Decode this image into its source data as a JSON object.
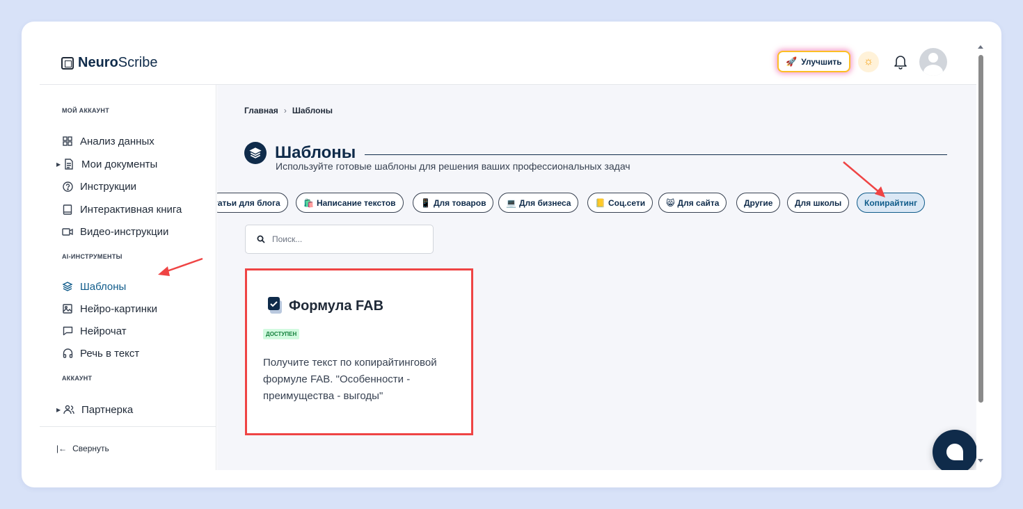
{
  "header": {
    "logo_bold": "Neuro",
    "logo_rest": "Scribe",
    "upgrade_label": "Улучшить"
  },
  "sidebar": {
    "sections": [
      {
        "title": "МОЙ АККАУНТ",
        "items": [
          {
            "label": "Анализ данных",
            "icon": "grid-icon"
          },
          {
            "label": "Мои документы",
            "icon": "document-icon",
            "expandable": true
          },
          {
            "label": "Инструкции",
            "icon": "help-circle-icon"
          },
          {
            "label": "Интерактивная книга",
            "icon": "book-icon"
          },
          {
            "label": "Видео-инструкции",
            "icon": "video-icon"
          }
        ]
      },
      {
        "title": "AI-ИНСТРУМЕНТЫ",
        "items": [
          {
            "label": "Шаблоны",
            "icon": "layers-icon",
            "active": true
          },
          {
            "label": "Нейро-картинки",
            "icon": "image-icon"
          },
          {
            "label": "Нейрочат",
            "icon": "chat-icon"
          },
          {
            "label": "Речь в текст",
            "icon": "headphones-icon"
          }
        ]
      },
      {
        "title": "АККАУНТ",
        "items": [
          {
            "label": "Партнерка",
            "icon": "users-icon",
            "expandable": true
          }
        ]
      }
    ],
    "collapse_label": "Свернуть"
  },
  "main": {
    "breadcrumb": [
      "Главная",
      "Шаблоны"
    ],
    "title": "Шаблоны",
    "subtitle": "Используйте готовые шаблоны для решения ваших профессиональных задач",
    "categories": [
      {
        "label": "татьи для блога",
        "emoji": ""
      },
      {
        "label": "Написание текстов",
        "emoji": "🛍️"
      },
      {
        "label": "Для товаров",
        "emoji": "📱"
      },
      {
        "label": "Для бизнеса",
        "emoji": "💻"
      },
      {
        "label": "Соц.сети",
        "emoji": "📒"
      },
      {
        "label": "Для сайта",
        "emoji": "😸"
      },
      {
        "label": "Другие",
        "emoji": ""
      },
      {
        "label": "Для школы",
        "emoji": ""
      },
      {
        "label": "Копирайтинг",
        "emoji": "",
        "active": true
      }
    ],
    "search_placeholder": "Поиск...",
    "card": {
      "title": "Формула FAB",
      "badge": "ДОСТУПЕН",
      "description": "Получите текст по копирайтинговой формуле FAB. \"Особенности - преимущества - выгоды\""
    }
  },
  "colors": {
    "brand_dark": "#0f2b4a",
    "accent": "#0f5b8a",
    "annotation_red": "#ef4444",
    "badge_green_bg": "#d1fadf",
    "page_bg": "#d8e2f8"
  }
}
